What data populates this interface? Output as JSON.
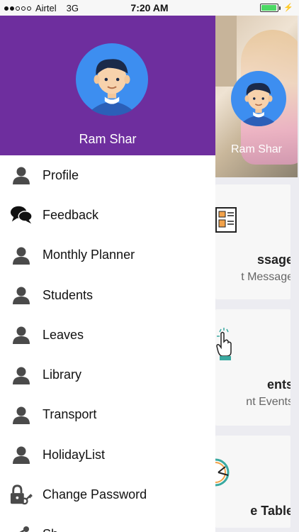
{
  "status_bar": {
    "carrier": "Airtel",
    "network": "3G",
    "time": "7:20 AM",
    "battery_level": 0.95
  },
  "drawer": {
    "user_name": "Ram Shar",
    "header_color": "#6e2e9e",
    "menu": [
      {
        "label": "Profile",
        "icon": "person-icon"
      },
      {
        "label": "Feedback",
        "icon": "chat-bubbles-icon"
      },
      {
        "label": "Monthly Planner",
        "icon": "person-icon"
      },
      {
        "label": "Students",
        "icon": "person-icon"
      },
      {
        "label": "Leaves",
        "icon": "person-icon"
      },
      {
        "label": "Library",
        "icon": "person-icon"
      },
      {
        "label": "Transport",
        "icon": "person-icon"
      },
      {
        "label": "HolidayList",
        "icon": "person-icon"
      },
      {
        "label": "Change Password",
        "icon": "lock-key-icon"
      },
      {
        "label": "Sh",
        "icon": "share-icon"
      }
    ]
  },
  "background": {
    "hero_name": "Ram Shar",
    "cards": [
      {
        "title": "ssage",
        "subtitle": "t Message",
        "icon": "notice-board-icon"
      },
      {
        "title": "ents",
        "subtitle": "nt Events",
        "icon": "tap-hand-icon"
      },
      {
        "title": "e Table",
        "subtitle": "",
        "icon": "clock-icon"
      }
    ]
  }
}
